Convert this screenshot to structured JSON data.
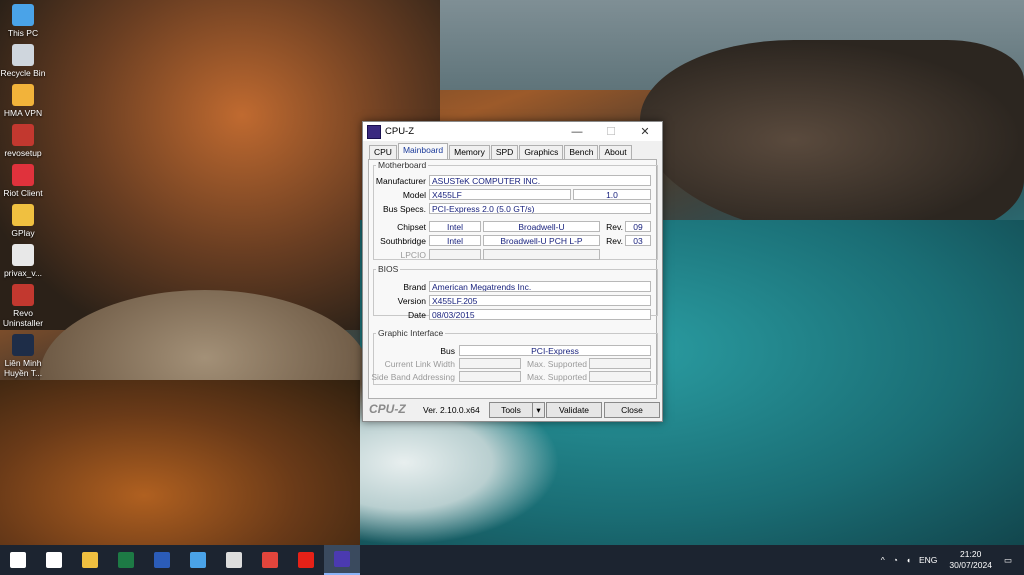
{
  "desktop": {
    "icons": [
      {
        "label": "This PC",
        "icon": "this-pc-icon",
        "color": "#4aa3e8"
      },
      {
        "label": "Recycle Bin",
        "icon": "recycle-bin-icon",
        "color": "#cfd6dd"
      },
      {
        "label": "HMA VPN",
        "icon": "hma-vpn-icon",
        "color": "#f2b33a"
      },
      {
        "label": "revosetup",
        "icon": "revo-setup-icon",
        "color": "#c2382f"
      },
      {
        "label": "Riot Client",
        "icon": "riot-client-icon",
        "color": "#e0323c"
      },
      {
        "label": "GPlay",
        "icon": "folder-icon",
        "color": "#f0c040"
      },
      {
        "label": "privax_v...",
        "icon": "privax-icon",
        "color": "#e8e8e8"
      },
      {
        "label": "Revo Uninstaller",
        "icon": "revo-uninstaller-icon",
        "color": "#c2382f"
      },
      {
        "label": "Liên Minh Huyền T...",
        "icon": "league-icon",
        "color": "#1e2d48"
      }
    ]
  },
  "window": {
    "title": "CPU-Z",
    "controls": {
      "minimize": "—",
      "maximize": "☐",
      "close": "✕"
    },
    "tabs": [
      "CPU",
      "Mainboard",
      "Memory",
      "SPD",
      "Graphics",
      "Bench",
      "About"
    ],
    "active_tab": "Mainboard",
    "motherboard": {
      "legend": "Motherboard",
      "manufacturer_label": "Manufacturer",
      "manufacturer": "ASUSTeK COMPUTER INC.",
      "model_label": "Model",
      "model": "X455LF",
      "model_rev": "1.0",
      "busspecs_label": "Bus Specs.",
      "busspecs": "PCI-Express 2.0 (5.0 GT/s)",
      "chipset_label": "Chipset",
      "chipset_vendor": "Intel",
      "chipset_name": "Broadwell-U",
      "chipset_rev_label": "Rev.",
      "chipset_rev": "09",
      "southbridge_label": "Southbridge",
      "southbridge_vendor": "Intel",
      "southbridge_name": "Broadwell-U PCH L-P",
      "southbridge_rev_label": "Rev.",
      "southbridge_rev": "03",
      "lpcio_label": "LPCIO"
    },
    "bios": {
      "legend": "BIOS",
      "brand_label": "Brand",
      "brand": "American Megatrends Inc.",
      "version_label": "Version",
      "version": "X455LF.205",
      "date_label": "Date",
      "date": "08/03/2015"
    },
    "graphic_interface": {
      "legend": "Graphic Interface",
      "bus_label": "Bus",
      "bus": "PCI-Express",
      "link_width_label": "Current Link Width",
      "max_supported_1": "Max. Supported",
      "side_band_label": "Side Band Addressing",
      "max_supported_2": "Max. Supported"
    },
    "footer": {
      "brand": "CPU-Z",
      "version": "Ver. 2.10.0.x64",
      "tools": "Tools",
      "validate": "Validate",
      "close": "Close"
    }
  },
  "taskbar": {
    "apps": [
      {
        "icon": "start-icon",
        "color": "#ffffff"
      },
      {
        "icon": "search-icon",
        "color": "#ffffff"
      },
      {
        "icon": "file-explorer-icon",
        "color": "#f0c040"
      },
      {
        "icon": "excel-icon",
        "color": "#1d7a45"
      },
      {
        "icon": "word-icon",
        "color": "#2b5cb8"
      },
      {
        "icon": "store-icon",
        "color": "#4aa3e8"
      },
      {
        "icon": "privax-icon",
        "color": "#dddddd"
      },
      {
        "icon": "chrome-icon",
        "color": "#e2453c"
      },
      {
        "icon": "youtube-icon",
        "color": "#e62117"
      },
      {
        "icon": "cpuz-icon",
        "color": "#4b3ab0"
      }
    ],
    "tray": {
      "language": "ENG",
      "time": "21:20",
      "date": "30/07/2024"
    }
  }
}
